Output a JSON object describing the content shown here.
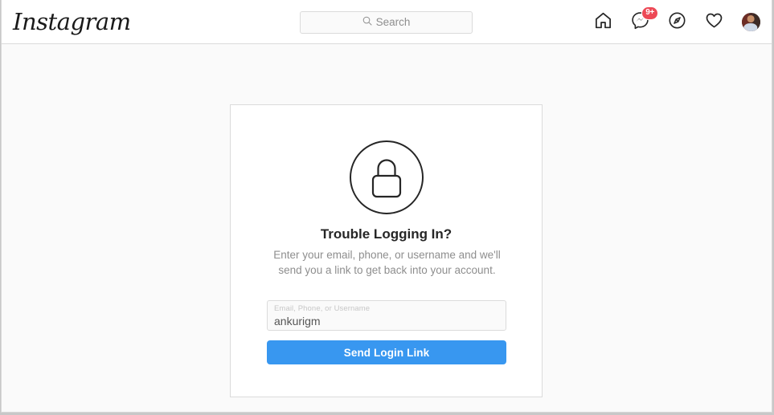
{
  "header": {
    "logo_text": "Instagram",
    "search": {
      "icon": "search-icon",
      "placeholder": "Search"
    },
    "nav": [
      {
        "name": "home-icon",
        "label": "Home"
      },
      {
        "name": "messenger-icon",
        "label": "Messages",
        "badge": "9+"
      },
      {
        "name": "compass-icon",
        "label": "Explore"
      },
      {
        "name": "heart-icon",
        "label": "Activity"
      },
      {
        "name": "avatar",
        "label": "Profile"
      }
    ],
    "badge_count": "9+"
  },
  "card": {
    "icon": "lock-icon",
    "title": "Trouble Logging In?",
    "description": "Enter your email, phone, or username and we'll send you a link to get back into your account.",
    "input": {
      "label": "Email, Phone, or Username",
      "value": "ankurigm",
      "placeholder": "Email, Phone, or Username"
    },
    "submit_label": "Send Login Link"
  },
  "colors": {
    "brand_blue": "#3897f0",
    "badge_red": "#ed4956",
    "page_bg": "#fafafa",
    "border": "#dbdbdb",
    "text_primary": "#262626",
    "text_secondary": "#8e8e8e"
  }
}
